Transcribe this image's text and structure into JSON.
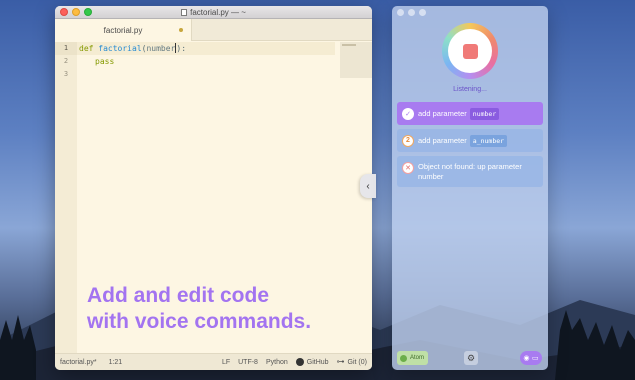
{
  "editor": {
    "window_title": "factorial.py — ~",
    "tab_label": "factorial.py",
    "line_numbers": [
      "1",
      "2",
      "3"
    ],
    "code": {
      "line1": {
        "kw": "def",
        "fn": "factorial",
        "paren_open": "(",
        "param": "number",
        "paren_close": "):"
      },
      "line2": "pass"
    },
    "promo_line1": "Add and edit code",
    "promo_line2": "with voice commands.",
    "status": {
      "file": "factorial.py*",
      "position": "1:21",
      "line_ending": "LF",
      "encoding": "UTF-8",
      "grammar": "Python",
      "github": "GitHub",
      "git": "Git (0)"
    }
  },
  "voice": {
    "status": "Listening...",
    "commands": [
      {
        "icon": "check-icon",
        "glyph": "✓",
        "text": "add parameter",
        "token": "number"
      },
      {
        "icon": "number-two-icon",
        "glyph": "2",
        "text": "add parameter",
        "token": "a_number"
      },
      {
        "icon": "error-x-icon",
        "glyph": "✕",
        "text": "Object not found: up parameter number"
      }
    ],
    "app_label": "Atom",
    "colors": {
      "accent": "#a87bf0",
      "stop": "#f07a78"
    }
  },
  "icons": {
    "collapse": "‹",
    "gear": "⚙",
    "wifi": "◉",
    "screen": "▭",
    "git": "⊶"
  }
}
